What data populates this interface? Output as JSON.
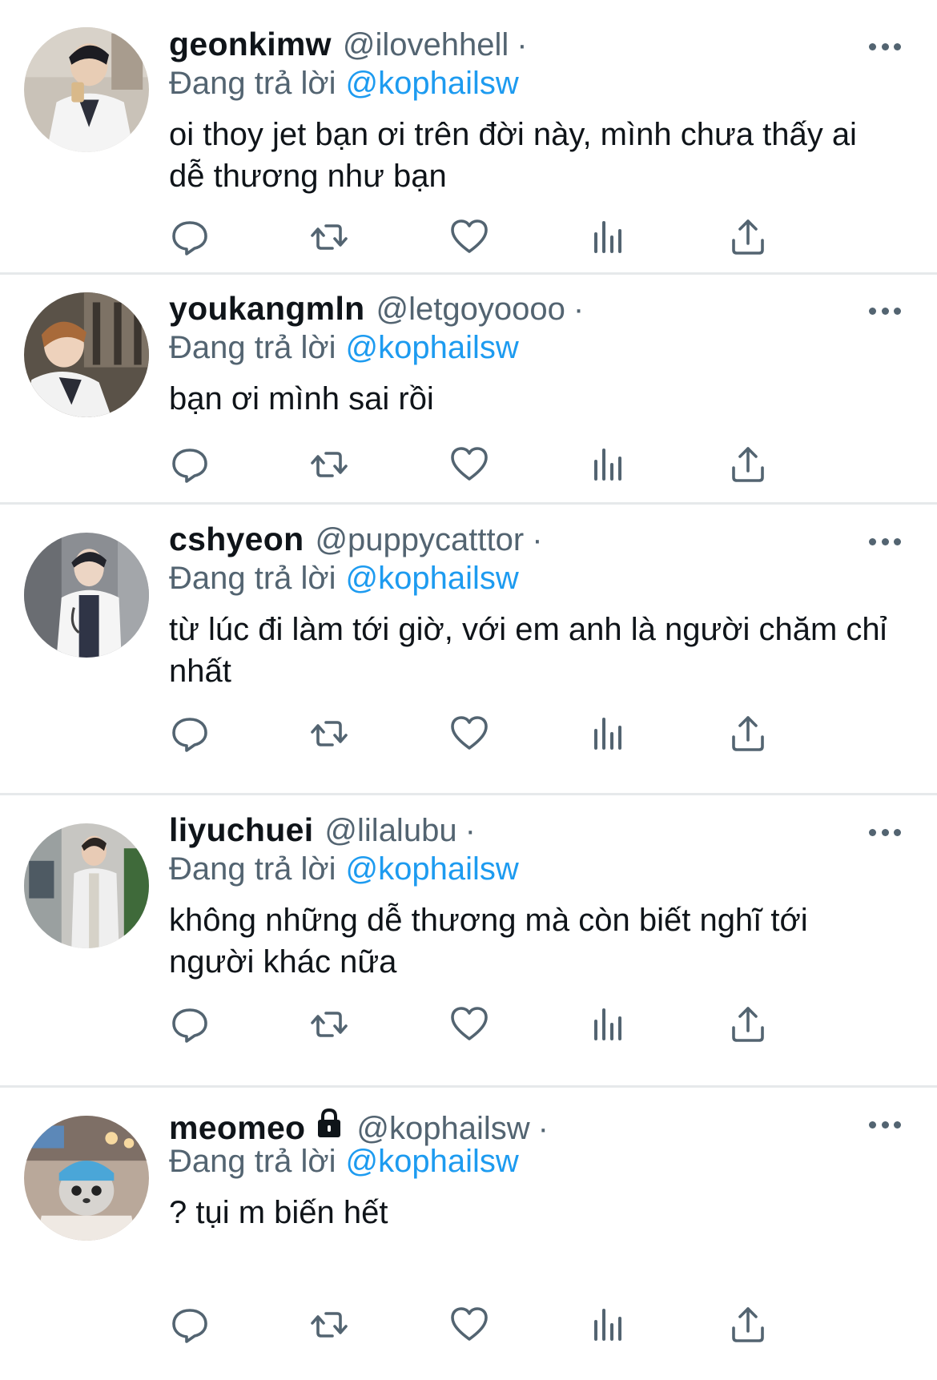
{
  "reply_prefix": "Đang trả lời",
  "more_icon": "more-horizontal-icon",
  "actions": [
    "reply-icon",
    "retweet-icon",
    "like-icon",
    "analytics-icon",
    "share-icon"
  ],
  "tweets": [
    {
      "name": "geonkimw",
      "handle": "@ilovehhell",
      "separator": "·",
      "replying_to": "@kophailsw",
      "text": "oi thoy jet bạn ơi trên đời này, mình chưa thấy ai dễ thương như bạn",
      "locked": false
    },
    {
      "name": "youkangmln",
      "handle": "@letgoyoooo",
      "separator": "·",
      "replying_to": "@kophailsw",
      "text": "bạn ơi mình sai rồi",
      "locked": false
    },
    {
      "name": "cshyeon",
      "handle": "@puppycatttor",
      "separator": "·",
      "replying_to": "@kophailsw",
      "text": "từ lúc đi làm tới giờ, với em anh là người chăm chỉ nhất",
      "locked": false
    },
    {
      "name": "liyuchuei",
      "handle": "@lilalubu",
      "separator": "·",
      "replying_to": "@kophailsw",
      "text": "không những dễ thương mà còn biết nghĩ tới người khác nữa",
      "locked": false
    },
    {
      "name": "meomeo",
      "handle": "@kophailsw",
      "separator": "·",
      "replying_to": "@kophailsw",
      "text": "? tụi m biến hết",
      "locked": true
    }
  ],
  "colors": {
    "mention": "#1d9bf0",
    "secondary_text": "#536471",
    "primary_text": "#0f1419",
    "divider": "#e6e9eb"
  }
}
